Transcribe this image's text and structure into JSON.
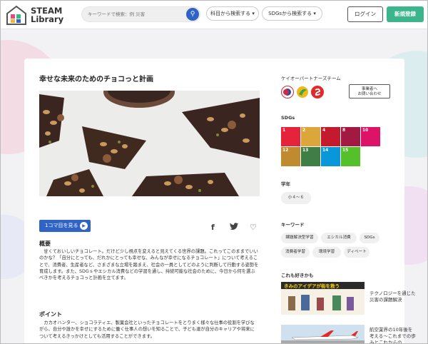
{
  "header": {
    "logo_line1": "STEAM",
    "logo_line2": "Library",
    "search_placeholder": "キーワードで検索：例 災害",
    "subject_dropdown": "科目から検索する",
    "sdgs_dropdown": "SDGsから検索する",
    "login_label": "ログイン",
    "signup_label": "新規登録"
  },
  "content": {
    "title": "幸せな未来のためのチョコっと計画",
    "watch_button": "1コマ目を見る",
    "overview_heading": "概要",
    "overview_text": "　甘くておいしいチョコレート。だけど少し視点を変えると見えてくる世界の課題。これってこのままでいいのかな？「自分にとっても、だれかにとっても幸せな、みんなが幸せになるチョコレート」について考えることで、消費者、生産者など、さまざまな立場を踏まえ、社会の一員としてどのように判断して行動する姿勢を育成します。また、SDGｓやエシカル消費などの学習を通し、持続可能な社会のために、今日から何を選ぶべきかを考えるチョコっと計画を立てます。",
    "point_heading": "ポイント",
    "point_text": "　カカオハンター、ショコラティエ、製菓会社といったチョコレートをとりまく様々な仕事の役割を学びながら、自分や誰かを幸せにするために働く仕事人の想いを知ることで、子ども達が自分のキャリアや将来について考えるきっかけとしても活用することができます。"
  },
  "sidebar": {
    "partner_label": "ケイオーパートナーズチーム",
    "contact_line1": "事業者へ",
    "contact_line2": "お問い合わせ",
    "sdgs_label": "SDGs",
    "sdgs": [
      {
        "num": "1",
        "color": "#e5243b"
      },
      {
        "num": "2",
        "color": "#dda63a"
      },
      {
        "num": "4",
        "color": "#c5192d"
      },
      {
        "num": "8",
        "color": "#a21942"
      },
      {
        "num": "10",
        "color": "#dd1367"
      },
      {
        "num": "12",
        "color": "#bf8b2e"
      },
      {
        "num": "13",
        "color": "#3f7e44"
      },
      {
        "num": "14",
        "color": "#0a97d9"
      },
      {
        "num": "15",
        "color": "#56c02b"
      }
    ],
    "grade_label": "学年",
    "grade_value": "小４～６",
    "keyword_label": "キーワード",
    "keywords": [
      "課題解決型学習",
      "エシカル消費",
      "SDGs",
      "消費者学習",
      "環境学習",
      "ディベート"
    ],
    "recommend_label": "これも好きかも",
    "recommend": [
      {
        "thumb_text": "きみのアイデアが街を救う",
        "title": "テクノロジーを通じた災害の課題解決"
      },
      {
        "title": "航空業界の10年後を考える～これまでの歩みとこれからの…"
      }
    ]
  }
}
